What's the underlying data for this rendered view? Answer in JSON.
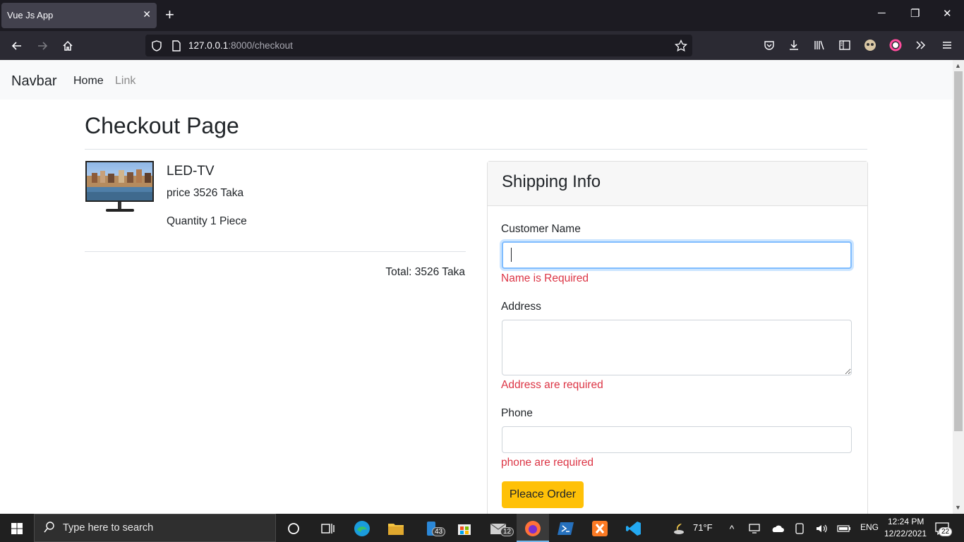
{
  "browser": {
    "tab_title": "Vue Js App",
    "url_host": "127.0.0.1",
    "url_rest": ":8000/checkout"
  },
  "nav": {
    "brand": "Navbar",
    "links": [
      "Home",
      "Link"
    ]
  },
  "page": {
    "title": "Checkout Page",
    "product": {
      "name": "LED-TV",
      "price": "price 3526 Taka",
      "quantity": "Quantity 1 Piece"
    },
    "total": "Total: 3526 Taka"
  },
  "shipping": {
    "title": "Shipping Info",
    "name_label": "Customer Name",
    "name_value": "",
    "name_error": "Name is Required",
    "address_label": "Address",
    "address_value": "",
    "address_error": "Address are required",
    "phone_label": "Phone",
    "phone_value": "",
    "phone_error": "phone are required",
    "submit_label": "Pleace Order"
  },
  "taskbar": {
    "search_placeholder": "Type here to search",
    "badge_a": "43",
    "badge_b": "12",
    "weather": "71°F",
    "lang": "ENG",
    "time": "12:24 PM",
    "date": "12/22/2021",
    "notifications": "22"
  },
  "colors": {
    "accent_button": "#ffc107",
    "error": "#dc3545",
    "focus_ring": "#80bdff"
  }
}
